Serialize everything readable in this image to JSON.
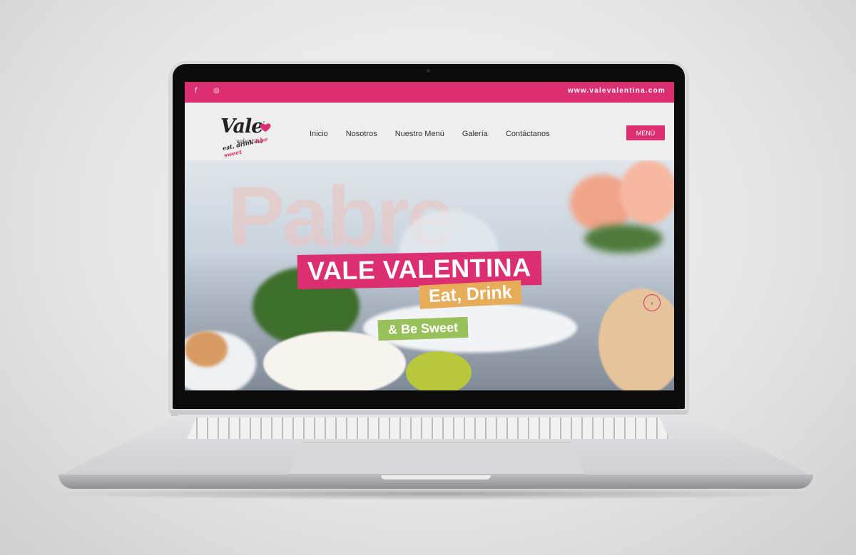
{
  "topbar": {
    "social": [
      "facebook-icon",
      "instagram-icon"
    ],
    "facebook_glyph": "f",
    "instagram_glyph": "◎",
    "url": "www.valevalentina.com"
  },
  "logo": {
    "main": "Vale",
    "sub": "valentina",
    "tag_a": "eat, drink ",
    "tag_b": "&be sweet"
  },
  "nav": {
    "links": [
      "Inicio",
      "Nosotros",
      "Nuestro Menú",
      "Galería",
      "Contáctanos"
    ],
    "menu_button": "MENÚ"
  },
  "hero": {
    "title": "VALE VALENTINA",
    "subtitle_1": "Eat, Drink",
    "subtitle_2": "& Be Sweet",
    "background_letters": "Pabre",
    "next_glyph": "›"
  },
  "colors": {
    "brand_pink": "#dc2f71",
    "accent_orange": "#e6ac5a",
    "accent_green": "#98c15b"
  }
}
